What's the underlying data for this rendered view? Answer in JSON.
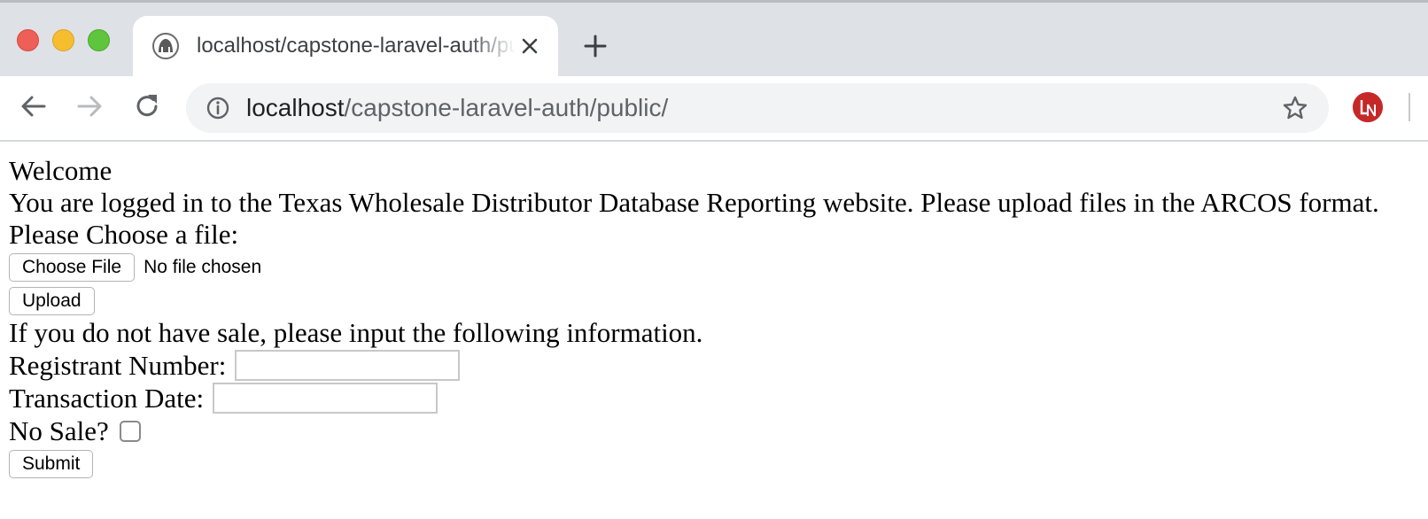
{
  "browser": {
    "tab_title": "localhost/capstone-laravel-auth/public/",
    "url_host": "localhost",
    "url_path": "/capstone-laravel-auth/public/",
    "icons": {
      "back": "arrow-left-icon",
      "forward": "arrow-right-icon",
      "reload": "reload-icon",
      "site_info": "info-icon",
      "bookmark": "star-icon",
      "tab_close": "close-icon",
      "new_tab": "plus-icon"
    },
    "colors": {
      "tabstrip": "#dee1e6",
      "omnibox": "#f1f3f4",
      "close_red": "#ee5f57",
      "minimize_yellow": "#f6bd2f",
      "maximize_green": "#5fc53c",
      "profile_red": "#c62828"
    }
  },
  "page": {
    "welcome": "Welcome",
    "intro": "You are logged in to the Texas Wholesale Distributor Database Reporting website. Please upload files in the ARCOS format.",
    "choose_prompt": "Please Choose a file:",
    "choose_file_label": "Choose File",
    "file_status": "No file chosen",
    "upload_label": "Upload",
    "no_sale_intro": "If you do not have sale, please input the following information.",
    "registrant_label": "Registrant Number:",
    "registrant_value": "",
    "date_label": "Transaction Date:",
    "date_value": "",
    "no_sale_label": "No Sale?",
    "no_sale_checked": false,
    "submit_label": "Submit"
  }
}
